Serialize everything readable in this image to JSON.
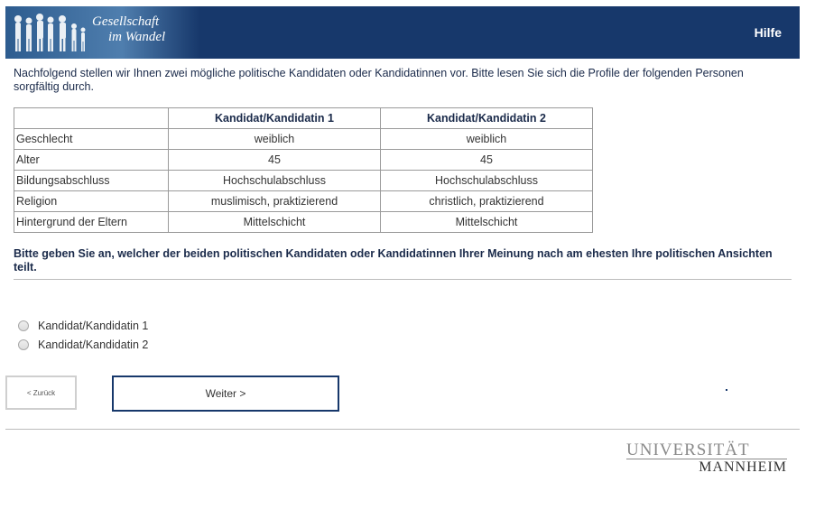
{
  "header": {
    "logo_line1": "Gesellschaft",
    "logo_line2": "im Wandel",
    "help_label": "Hilfe"
  },
  "intro": "Nachfolgend stellen wir Ihnen zwei mögliche politische Kandidaten oder Kandidatinnen vor. Bitte lesen Sie sich die Profile der folgenden Personen sorgfältig durch.",
  "table": {
    "headers": [
      "",
      "Kandidat/Kandidatin 1",
      "Kandidat/Kandidatin 2"
    ],
    "rows": [
      {
        "attr": "Geschlecht",
        "c1": "weiblich",
        "c2": "weiblich"
      },
      {
        "attr": "Alter",
        "c1": "45",
        "c2": "45"
      },
      {
        "attr": "Bildungsabschluss",
        "c1": "Hochschulabschluss",
        "c2": "Hochschulabschluss"
      },
      {
        "attr": "Religion",
        "c1": "muslimisch, praktizierend",
        "c2": "christlich, praktizierend"
      },
      {
        "attr": "Hintergrund der Eltern",
        "c1": "Mittelschicht",
        "c2": "Mittelschicht"
      }
    ]
  },
  "question": "Bitte geben Sie an, welcher der beiden politischen Kandidaten oder Kandidatinnen Ihrer Meinung nach am ehesten Ihre politischen Ansichten teilt.",
  "options": [
    "Kandidat/Kandidatin 1",
    "Kandidat/Kandidatin 2"
  ],
  "nav": {
    "back_label": "< Zurück",
    "next_label": "Weiter >"
  },
  "footer": {
    "uni_line1": "UNIVERSITÄT",
    "uni_line2": "MANNHEIM"
  }
}
